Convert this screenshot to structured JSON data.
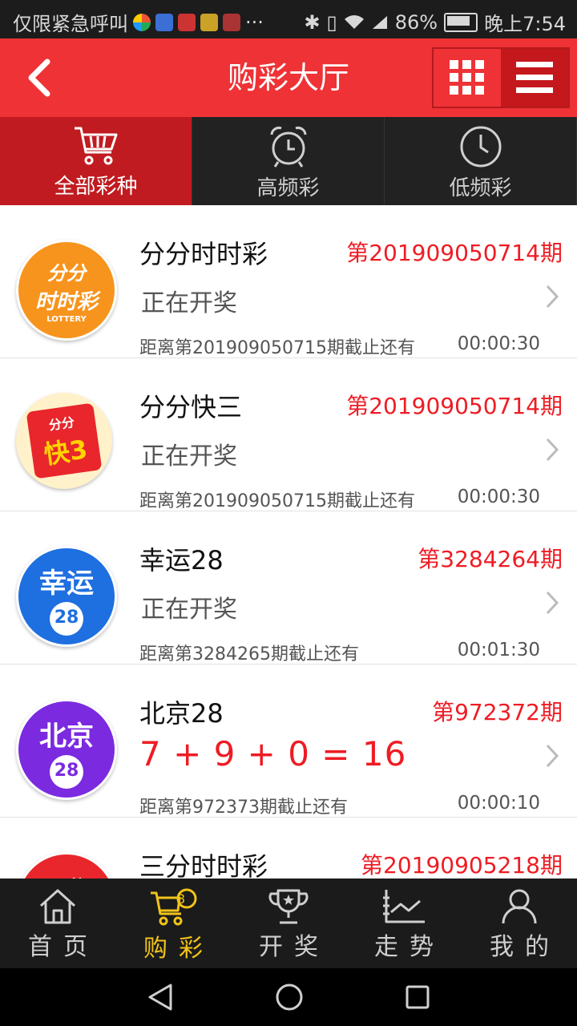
{
  "status_bar": {
    "carrier_text": "仅限紧急呼叫",
    "more_icons": "···",
    "battery": "86%",
    "time": "晚上7:54",
    "icons": [
      "bluetooth-icon",
      "vibrate-icon",
      "wifi-icon",
      "signal-icon",
      "battery-icon"
    ]
  },
  "header": {
    "title": "购彩大厅",
    "back_icon": "back-arrow-icon",
    "grid_icon": "grid-icon",
    "menu_icon": "hamburger-menu-icon"
  },
  "category_tabs": [
    {
      "label": "全部彩种",
      "icon": "cart-icon",
      "active": true
    },
    {
      "label": "高频彩",
      "icon": "alarm-clock-icon",
      "active": false
    },
    {
      "label": "低频彩",
      "icon": "clock-icon",
      "active": false
    }
  ],
  "lotteries": [
    {
      "name": "分分时时彩",
      "period": "第201909050714期",
      "status": "正在开奖",
      "deadline": "距离第201909050715期截止还有",
      "countdown": "00:00:30",
      "logo": {
        "line1": "分分",
        "line2": "时时彩",
        "line3": "LOTTERY",
        "color": "#f7941d"
      }
    },
    {
      "name": "分分快三",
      "period": "第201909050714期",
      "status": "正在开奖",
      "deadline": "距离第201909050715期截止还有",
      "countdown": "00:00:30",
      "logo": {
        "line1": "分分",
        "line2": "快3",
        "color": "#e8262b",
        "bg": "#fff4d6"
      }
    },
    {
      "name": "幸运28",
      "period": "第3284264期",
      "status": "正在开奖",
      "deadline": "距离第3284265期截止还有",
      "countdown": "00:01:30",
      "logo": {
        "line1": "幸运",
        "line2": "28",
        "color": "#1e6fe0"
      }
    },
    {
      "name": "北京28",
      "period": "第972372期",
      "result": "7 + 9 + 0 = 16",
      "deadline": "距离第972373期截止还有",
      "countdown": "00:00:10",
      "logo": {
        "line1": "北京",
        "line2": "28",
        "color": "#7b2ae0"
      }
    },
    {
      "name": "三分时时彩",
      "period": "第2019090521 8期",
      "logo": {
        "line1": "三分",
        "color": "#e8262b"
      }
    }
  ],
  "bottom_nav": [
    {
      "label": "首页",
      "icon": "home-icon",
      "active": false
    },
    {
      "label": "购彩",
      "icon": "shopping-cart-badge-icon",
      "active": true,
      "badge": "8"
    },
    {
      "label": "开奖",
      "icon": "trophy-icon",
      "active": false
    },
    {
      "label": "走势",
      "icon": "trend-chart-icon",
      "active": false
    },
    {
      "label": "我的",
      "icon": "user-icon",
      "active": false
    }
  ],
  "system_nav": [
    "back-triangle-icon",
    "home-circle-icon",
    "recents-square-icon"
  ]
}
